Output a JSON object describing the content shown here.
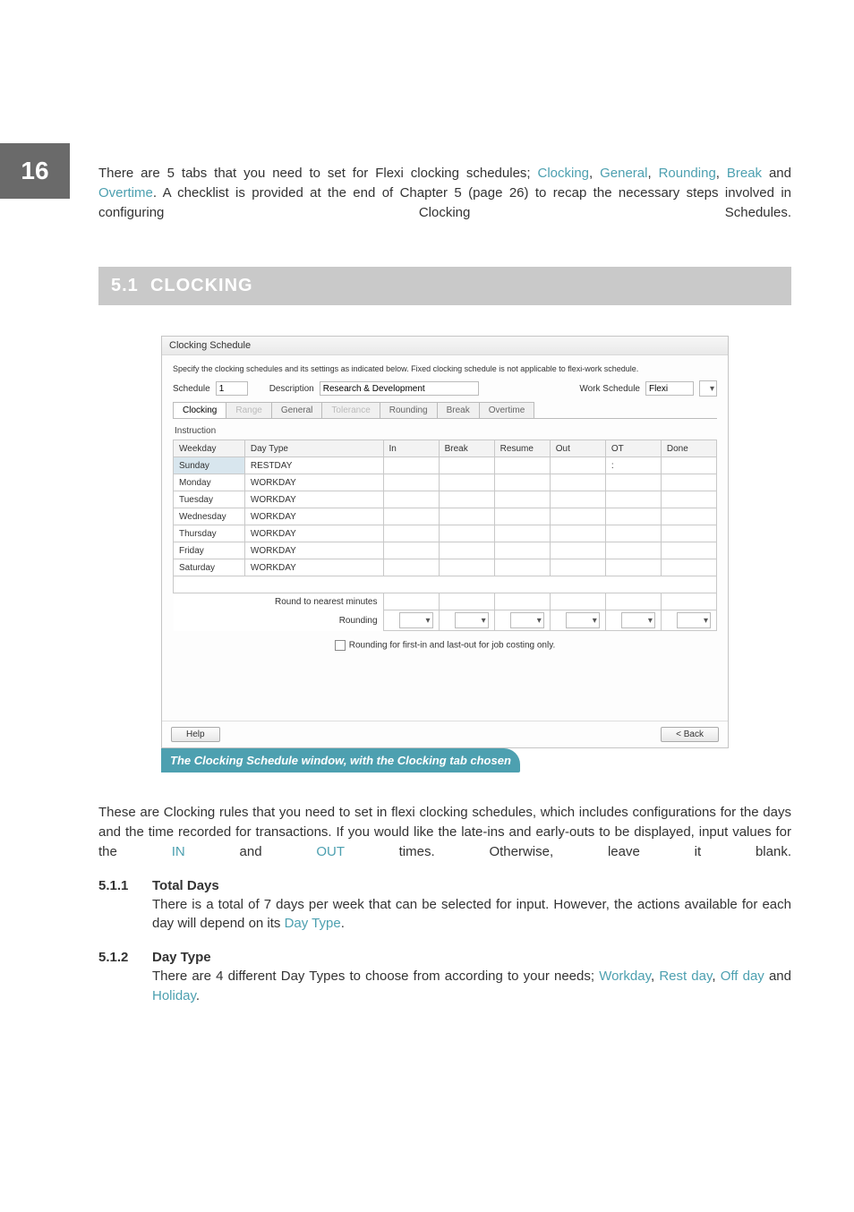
{
  "page_number": "16",
  "intro": {
    "line1_a": "There are 5 tabs that you need to set for Flexi clocking schedules; ",
    "clocking": "Clocking",
    "comma1": ", ",
    "general": "General",
    "comma2": ", ",
    "rounding": "Rounding",
    "comma3": ", ",
    "break": "Break",
    "and": " and ",
    "overtime": "Overtime",
    "line1_b": ". A checklist is provided at the end of Chapter 5 (page 26) to recap the necessary steps involved in configuring Clocking Schedules."
  },
  "section": {
    "num": "5.1",
    "title": "CLOCKING"
  },
  "win": {
    "title": "Clocking Schedule",
    "note": "Specify the clocking schedules and its settings as indicated below. Fixed clocking schedule is not applicable to flexi-work schedule.",
    "labels": {
      "schedule": "Schedule",
      "description": "Description",
      "work_schedule": "Work Schedule"
    },
    "values": {
      "schedule": "1",
      "description": "Research & Development",
      "work_schedule": "Flexi"
    },
    "tabs": [
      "Clocking",
      "Range",
      "General",
      "Tolerance",
      "Rounding",
      "Break",
      "Overtime"
    ],
    "tabs_disabled": [
      1,
      3
    ],
    "instruction": "Instruction",
    "headers": [
      "Weekday",
      "Day Type",
      "In",
      "Break",
      "Resume",
      "Out",
      "OT",
      "Done"
    ],
    "rows": [
      {
        "weekday": "Sunday",
        "daytype": "RESTDAY",
        "sel": true,
        "ot": ":"
      },
      {
        "weekday": "Monday",
        "daytype": "WORKDAY"
      },
      {
        "weekday": "Tuesday",
        "daytype": "WORKDAY"
      },
      {
        "weekday": "Wednesday",
        "daytype": "WORKDAY"
      },
      {
        "weekday": "Thursday",
        "daytype": "WORKDAY"
      },
      {
        "weekday": "Friday",
        "daytype": "WORKDAY"
      },
      {
        "weekday": "Saturday",
        "daytype": "WORKDAY"
      }
    ],
    "round_label": "Round to nearest minutes",
    "rounding_label": "Rounding",
    "checkbox_label": "Rounding for first-in and last-out for job costing only.",
    "help": "Help",
    "back": "< Back"
  },
  "caption": "The Clocking Schedule window, with the Clocking tab chosen",
  "body": {
    "p1_a": "These are Clocking rules that you need to set in flexi clocking schedules, which includes configurations for the days and the time recorded for transactions. If you would like the late-ins and early-outs to be displayed, input values for the ",
    "in": "IN",
    "and": " and ",
    "out": "OUT",
    "p1_b": " times. Otherwise, leave it blank."
  },
  "sub1": {
    "num": "5.1.1",
    "title": "Total Days",
    "text_a": "There is a total of 7 days per week that can be selected for input. However, the actions available for each day will depend on its ",
    "daytype": "Day Type",
    "dot": "."
  },
  "sub2": {
    "num": "5.1.2",
    "title": "Day Type",
    "text_a": "There are 4 different Day Types to choose from according to your needs; ",
    "workday": "Workday",
    "c1": ", ",
    "restday": "Rest day",
    "c2": ", ",
    "offday": "Off day",
    "and": " and ",
    "holiday": "Holiday",
    "dot": "."
  }
}
